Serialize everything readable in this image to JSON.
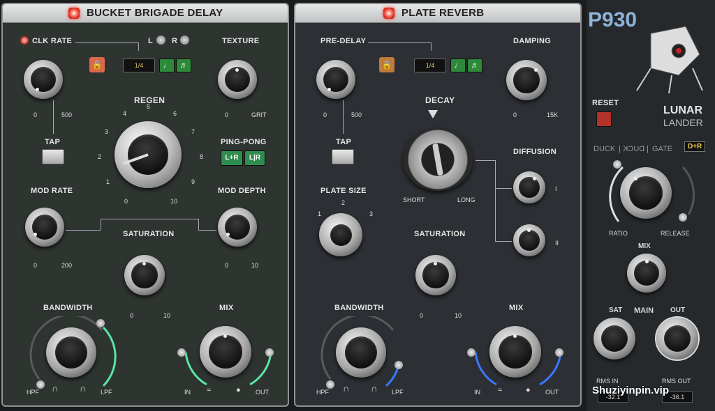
{
  "bbd": {
    "title": "BUCKET BRIGADE DELAY",
    "clk_rate": {
      "label": "CLK RATE",
      "min": "0",
      "max": "500"
    },
    "lr": {
      "l": "L",
      "r": "R"
    },
    "division": "1/4",
    "texture": {
      "label": "TEXTURE",
      "min": "0",
      "max": "GRIT"
    },
    "regen": {
      "label": "REGEN",
      "ticks": [
        "0",
        "1",
        "2",
        "3",
        "4",
        "5",
        "6",
        "7",
        "8",
        "9",
        "10"
      ]
    },
    "tap": "TAP",
    "ping_pong": {
      "label": "PING-PONG",
      "lr_label": "L+R",
      "lr2_label": "L|R"
    },
    "mod_rate": {
      "label": "MOD RATE",
      "min": "0",
      "max": "200"
    },
    "mod_depth": {
      "label": "MOD DEPTH",
      "min": "0",
      "max": "10"
    },
    "saturation": {
      "label": "SATURATION",
      "min": "0",
      "max": "10"
    },
    "bandwidth": {
      "label": "BANDWIDTH",
      "hpf": "HPF",
      "lpf": "LPF"
    },
    "mix": {
      "label": "MIX",
      "in": "IN",
      "out": "OUT"
    }
  },
  "plate": {
    "title": "PLATE REVERB",
    "pre_delay": {
      "label": "PRE-DELAY",
      "min": "0",
      "max": "500"
    },
    "division": "1/4",
    "damping": {
      "label": "DAMPING",
      "min": "0",
      "max": "15K"
    },
    "decay": {
      "label": "DECAY",
      "short": "SHORT",
      "long": "LONG"
    },
    "tap": "TAP",
    "plate_size": {
      "label": "PLATE SIZE",
      "one": "1",
      "two": "2",
      "three": "3"
    },
    "diffusion": {
      "label": "DIFFUSION",
      "one": "I",
      "two": "II"
    },
    "saturation": {
      "label": "SATURATION",
      "min": "0",
      "max": "10"
    },
    "bandwidth": {
      "label": "BANDWIDTH",
      "hpf": "HPF",
      "lpf": "LPF"
    },
    "mix": {
      "label": "MIX",
      "in": "IN",
      "out": "OUT"
    }
  },
  "side": {
    "brand": "P930",
    "product_line1": "LUNAR",
    "product_line2": "LANDER",
    "reset": "RESET",
    "mode": {
      "duck": "DUCK",
      "kcud": "DUCK",
      "sep": "|",
      "gate": "GATE",
      "dr": "D+R"
    },
    "ratio": "RATIO",
    "release": "RELEASE",
    "mix": "MIX",
    "sat": "SAT",
    "main": "MAIN",
    "out": "OUT",
    "rms_in": {
      "label": "RMS IN",
      "value": "-32.1"
    },
    "rms_out": {
      "label": "RMS OUT",
      "value": "-36.1"
    }
  },
  "watermark": "Shuziyinpin.vip",
  "colors": {
    "led_red": "#e0261c",
    "green": "#2f8d4d",
    "arc_green": "#59e6a5",
    "arc_blue": "#3a77ff"
  }
}
